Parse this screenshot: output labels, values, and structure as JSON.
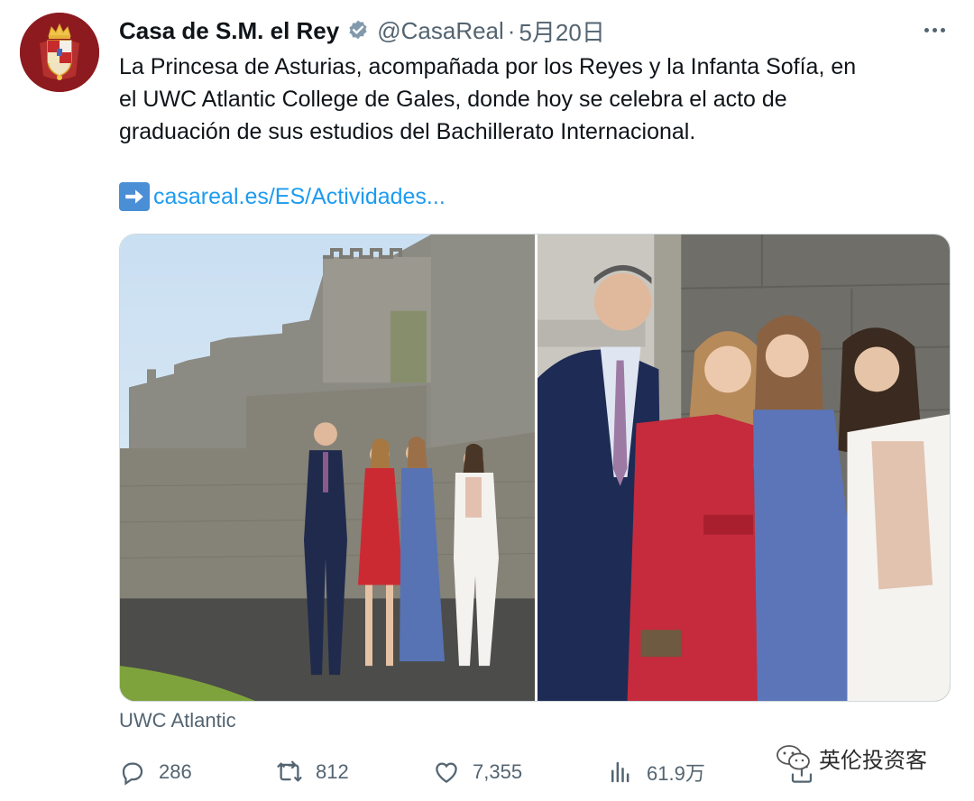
{
  "tweet": {
    "author": {
      "display_name": "Casa de S.M. el Rey",
      "handle": "@CasaReal",
      "separator": "·",
      "date": "5月20日",
      "verified": true,
      "avatar_icon": "royal-coat-of-arms"
    },
    "text_lines": [
      "La Princesa de Asturias, acompañada por los Reyes y la Infanta Sofía, en",
      "el UWC Atlantic College de Gales, donde hoy se celebra el acto de",
      "graduación de sus estudios del Bachillerato Internacional."
    ],
    "link": {
      "icon": "right-arrow-emoji",
      "text": "casareal.es/ES/Actividades..."
    },
    "media": {
      "count": 2,
      "photos": [
        {
          "description_icon": "family-at-castle-wall-photo"
        },
        {
          "description_icon": "family-closeup-photo"
        }
      ]
    },
    "location": "UWC Atlantic",
    "stats": {
      "replies": "286",
      "retweets": "812",
      "likes": "7,355",
      "views": "61.9万"
    }
  },
  "watermark": {
    "text": "英伦投资客",
    "icon": "wechat-icon"
  },
  "colors": {
    "link": "#1d9bf0",
    "verified_badge": "#829aab",
    "secondary_text": "#536471",
    "avatar_bg": "#8c1a1f"
  }
}
